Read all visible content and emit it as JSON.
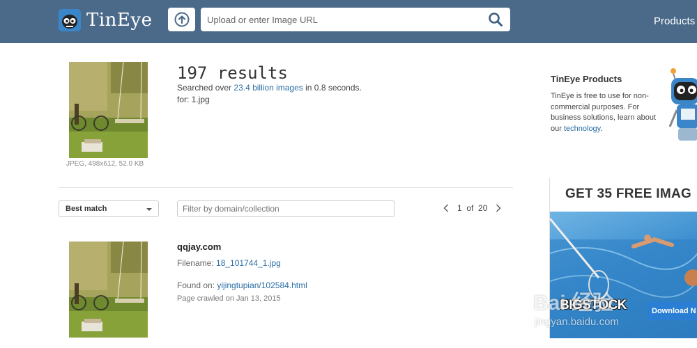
{
  "header": {
    "logo_text": "TinEye",
    "search_placeholder": "Upload or enter Image URL",
    "nav_products": "Products"
  },
  "query": {
    "results_count": "197 results",
    "searched_prefix": "Searched over ",
    "searched_link": "23.4 billion images",
    "searched_suffix": " in 0.8 seconds.",
    "for_line": "for: 1.jpg",
    "image_meta": "JPEG, 498x612, 52.0 KB"
  },
  "controls": {
    "sort_value": "Best match",
    "filter_placeholder": "Filter by domain/collection",
    "page_current": "1",
    "page_of": "of",
    "page_total": "20"
  },
  "result": {
    "domain": "qqjay.com",
    "filename_label": "Filename: ",
    "filename": "18_101744_1.jpg",
    "found_on_label": "Found on: ",
    "found_on": "yijingtupian/102584.html",
    "crawled": "Page crawled on Jan 13, 2015"
  },
  "sidebar": {
    "title": "TinEye Products",
    "text_1": "TinEye is free to use for non-commercial purposes. For business solutions, learn about our ",
    "link": "technology",
    "text_2": "."
  },
  "ad": {
    "headline": "GET 35 FREE IMAG",
    "brand": "BIGSTOCK",
    "download": "Download N"
  },
  "watermark": {
    "text": "Bai 经验",
    "url": "jingyan.baidu.com"
  },
  "colors": {
    "header_bg": "#4b6a8a",
    "link": "#2a6ea6",
    "ad_button": "#2a7fd4"
  }
}
